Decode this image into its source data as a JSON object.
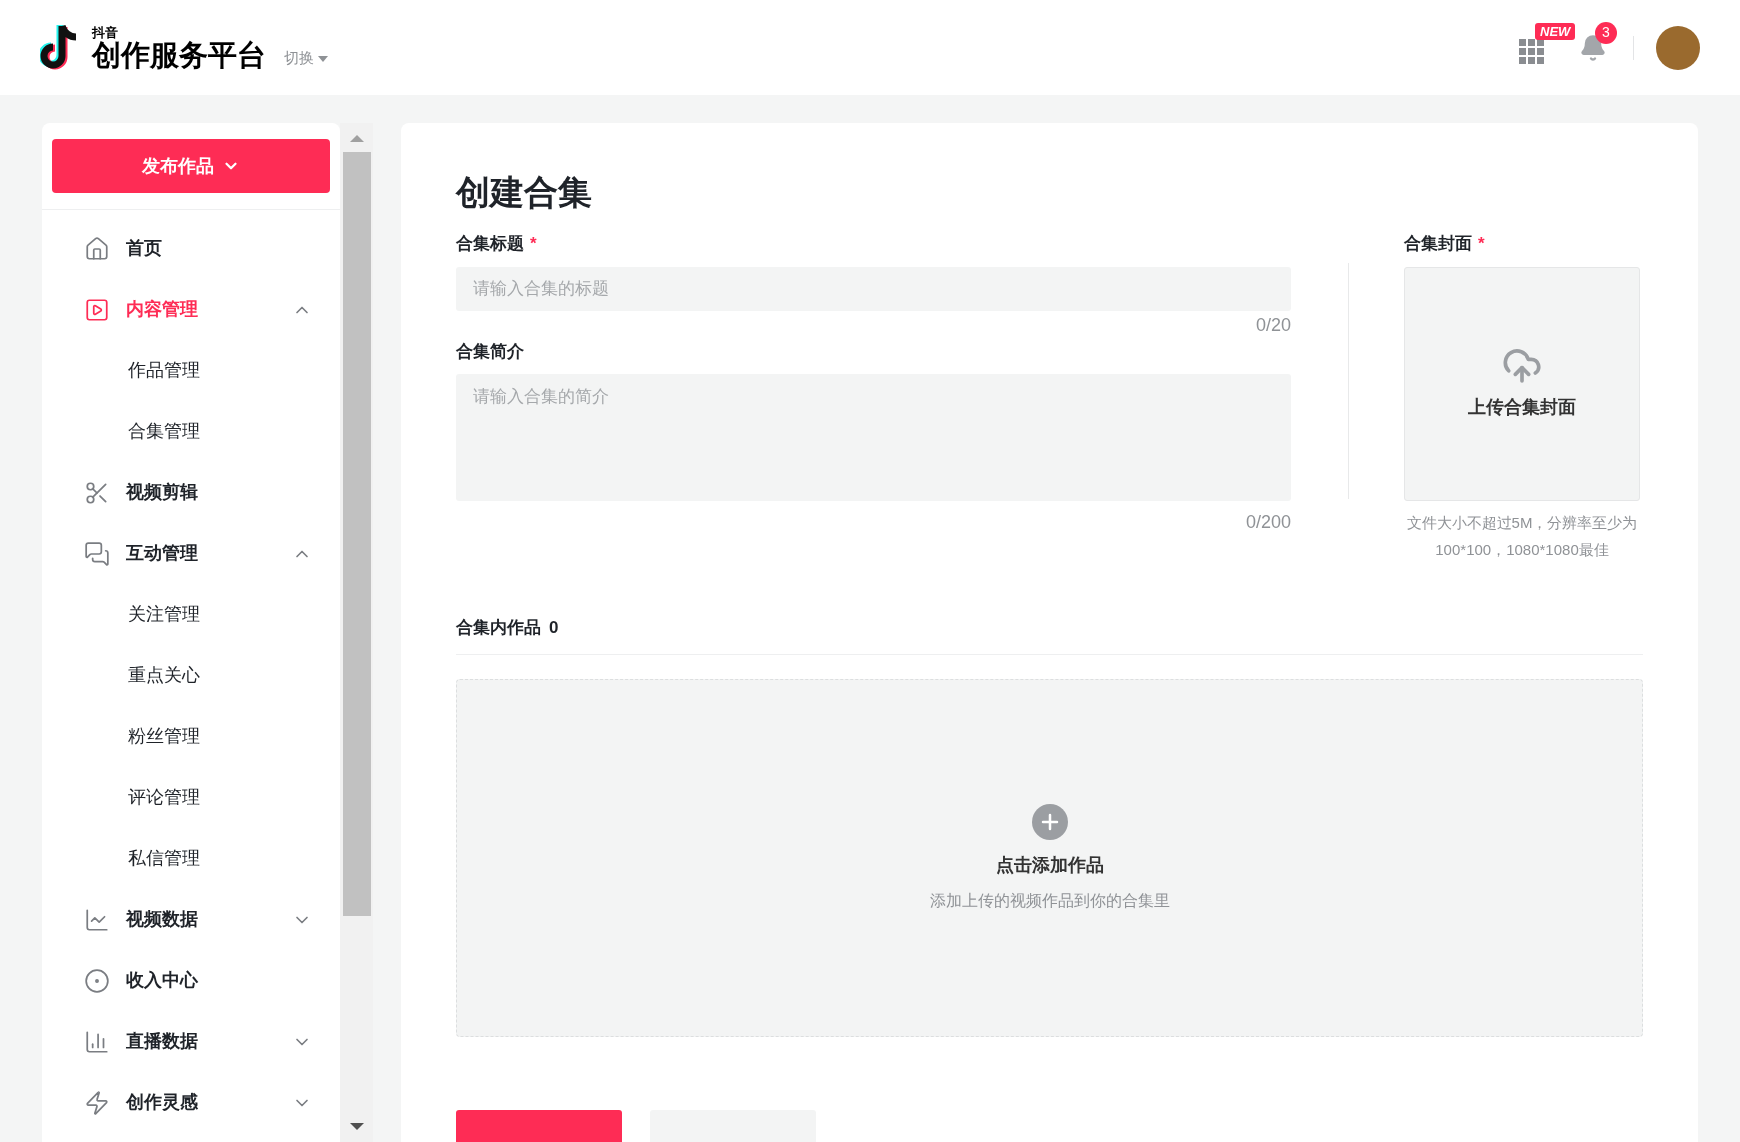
{
  "header": {
    "brand_small": "抖音",
    "brand": "创作服务平台",
    "switch": "切换",
    "new_badge": "NEW",
    "notification_count": "3"
  },
  "sidebar": {
    "publish_button": "发布作品",
    "items": [
      {
        "label": "首页",
        "selected": false
      },
      {
        "label": "内容管理",
        "selected": true,
        "expanded": true,
        "children": [
          {
            "label": "作品管理",
            "selected": false
          },
          {
            "label": "合集管理",
            "selected": false
          }
        ]
      },
      {
        "label": "视频剪辑",
        "selected": false
      },
      {
        "label": "互动管理",
        "selected": false,
        "expanded": true,
        "children": [
          {
            "label": "关注管理",
            "selected": false
          },
          {
            "label": "重点关心",
            "selected": false
          },
          {
            "label": "粉丝管理",
            "selected": false
          },
          {
            "label": "评论管理",
            "selected": false
          },
          {
            "label": "私信管理",
            "selected": false
          }
        ]
      },
      {
        "label": "视频数据",
        "selected": false,
        "expanded": false
      },
      {
        "label": "收入中心",
        "selected": false
      },
      {
        "label": "直播数据",
        "selected": false,
        "expanded": false
      },
      {
        "label": "创作灵感",
        "selected": false,
        "expanded": false
      }
    ]
  },
  "form": {
    "title": "创建合集",
    "title_field": {
      "label": "合集标题",
      "required_mark": "*",
      "placeholder": "请输入合集的标题",
      "counter": "0/20"
    },
    "intro_field": {
      "label": "合集简介",
      "placeholder": "请输入合集的简介",
      "counter": "0/200"
    },
    "cover": {
      "label": "合集封面",
      "required_mark": "*",
      "upload_text": "上传合集封面",
      "hint": "文件大小不超过5M，分辨率至少为100*100，1080*1080最佳"
    },
    "works": {
      "label": "合集内作品",
      "count": "0",
      "add_title": "点击添加作品",
      "add_hint": "添加上传的视频作品到你的合集里"
    }
  }
}
